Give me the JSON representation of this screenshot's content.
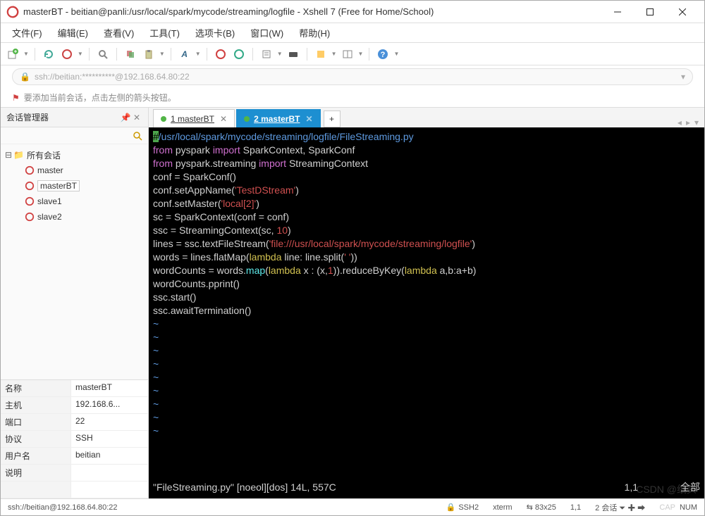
{
  "title": "masterBT - beitian@panli:/usr/local/spark/mycode/streaming/logfile - Xshell 7 (Free for Home/School)",
  "menu": [
    "文件(F)",
    "编辑(E)",
    "查看(V)",
    "工具(T)",
    "选项卡(B)",
    "窗口(W)",
    "帮助(H)"
  ],
  "address": "ssh://beitian:**********@192.168.64.80:22",
  "info": "要添加当前会话，点击左侧的箭头按钮。",
  "sidebar": {
    "title": "会话管理器",
    "root": "所有会话",
    "items": [
      "master",
      "masterBT",
      "slave1",
      "slave2"
    ],
    "selected": 1
  },
  "props": [
    {
      "k": "名称",
      "v": "masterBT"
    },
    {
      "k": "主机",
      "v": "192.168.6..."
    },
    {
      "k": "端口",
      "v": "22"
    },
    {
      "k": "协议",
      "v": "SSH"
    },
    {
      "k": "用户名",
      "v": "beitian"
    },
    {
      "k": "说明",
      "v": ""
    }
  ],
  "tabs": [
    {
      "label": "1 masterBT",
      "active": false
    },
    {
      "label": "2 masterBT",
      "active": true
    }
  ],
  "code": {
    "shebang": "/usr/local/spark/mycode/streaming/logfile/FileStreaming.py",
    "l2a": "from",
    "l2b": " pyspark ",
    "l2c": "import",
    "l2d": " SparkContext, SparkConf",
    "l3a": "from",
    "l3b": " pyspark.streaming ",
    "l3c": "import",
    "l3d": " StreamingContext",
    "l4": "conf = SparkConf()",
    "l5a": "conf.setAppName(",
    "l5b": "'TestDStream'",
    "l5c": ")",
    "l6a": "conf.setMaster(",
    "l6b": "'local[2]'",
    "l6c": ")",
    "l7": "sc = SparkContext(conf = conf)",
    "l8a": "ssc = StreamingContext(sc, ",
    "l8b": "10",
    "l8c": ")",
    "l9a": "lines = ssc.textFileStream(",
    "l9b": "'file:///usr/local/spark/mycode/streaming/logfile'",
    "l9c": ")",
    "l10a": "words = lines.flatMap(",
    "l10b": "lambda",
    "l10c": " line: line.split(",
    "l10d": "' '",
    "l10e": "))",
    "l11a": "wordCounts = words.",
    "l11b": "map",
    "l11c": "(",
    "l11d": "lambda",
    "l11e": " x : (x,",
    "l11f": "1",
    "l11g": ")).reduceByKey(",
    "l11h": "lambda",
    "l11i": " a,b:a+b)",
    "l12": "wordCounts.pprint()",
    "l13": "ssc.start()",
    "l14": "ssc.awaitTermination()",
    "status_file": "\"FileStreaming.py\" [noeol][dos] 14L, 557C",
    "status_pos": "1,1",
    "status_all": "全部"
  },
  "statusbar": {
    "left": "ssh://beitian@192.168.64.80:22",
    "ssh": "SSH2",
    "term": "xterm",
    "size": "83x25",
    "pos": "1,1",
    "sess": "2 会话",
    "cap": "CAP",
    "num": "NUM"
  },
  "watermark": "CSDN @纸头"
}
